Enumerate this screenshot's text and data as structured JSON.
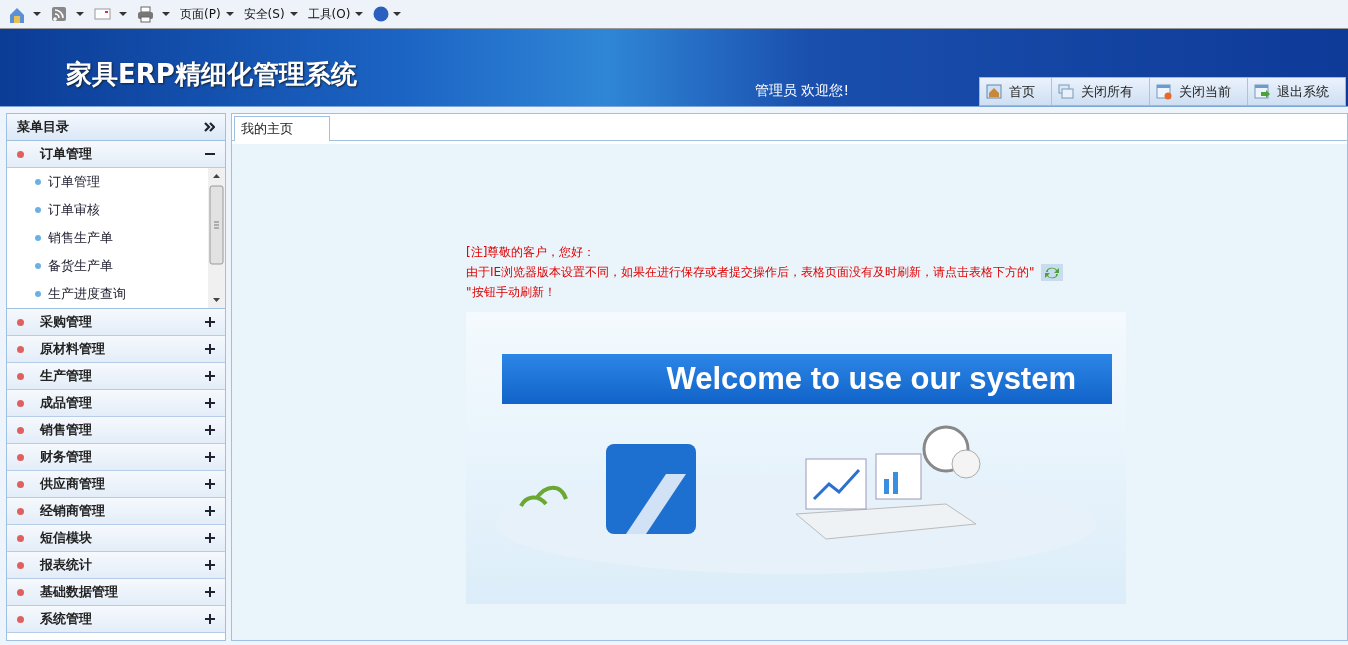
{
  "browser_toolbar": {
    "menus": [
      {
        "label": "页面(P)"
      },
      {
        "label": "安全(S)"
      },
      {
        "label": "工具(O)"
      }
    ]
  },
  "header": {
    "title": "家具ERP精细化管理系统",
    "welcome": "管理员 欢迎您!",
    "buttons": [
      {
        "label": "首页",
        "kind": "home"
      },
      {
        "label": "关闭所有",
        "kind": "close-all"
      },
      {
        "label": "关闭当前",
        "kind": "close-current"
      },
      {
        "label": "退出系统",
        "kind": "exit"
      }
    ]
  },
  "sidebar": {
    "title": "菜单目录",
    "sections": [
      {
        "label": "订单管理",
        "expanded": true,
        "children": [
          {
            "label": "订单管理"
          },
          {
            "label": "订单审核"
          },
          {
            "label": "销售生产单"
          },
          {
            "label": "备货生产单"
          },
          {
            "label": "生产进度查询"
          }
        ]
      },
      {
        "label": "采购管理",
        "expanded": false
      },
      {
        "label": "原材料管理",
        "expanded": false
      },
      {
        "label": "生产管理",
        "expanded": false
      },
      {
        "label": "成品管理",
        "expanded": false
      },
      {
        "label": "销售管理",
        "expanded": false
      },
      {
        "label": "财务管理",
        "expanded": false
      },
      {
        "label": "供应商管理",
        "expanded": false
      },
      {
        "label": "经销商管理",
        "expanded": false
      },
      {
        "label": "短信模块",
        "expanded": false
      },
      {
        "label": "报表统计",
        "expanded": false
      },
      {
        "label": "基础数据管理",
        "expanded": false
      },
      {
        "label": "系统管理",
        "expanded": false
      }
    ]
  },
  "tabs": [
    {
      "label": "我的主页",
      "selected": true
    }
  ],
  "notice": {
    "greeting": "[注]尊敬的客户，您好：",
    "line_1": "由于IE浏览器版本设置不同，如果在进行保存或者提交操作后，表格页面没有及时刷新，请点击表格下方的\"",
    "line_2": "\"按钮手动刷新！"
  },
  "banner": {
    "heading": "Welcome to use our system"
  }
}
